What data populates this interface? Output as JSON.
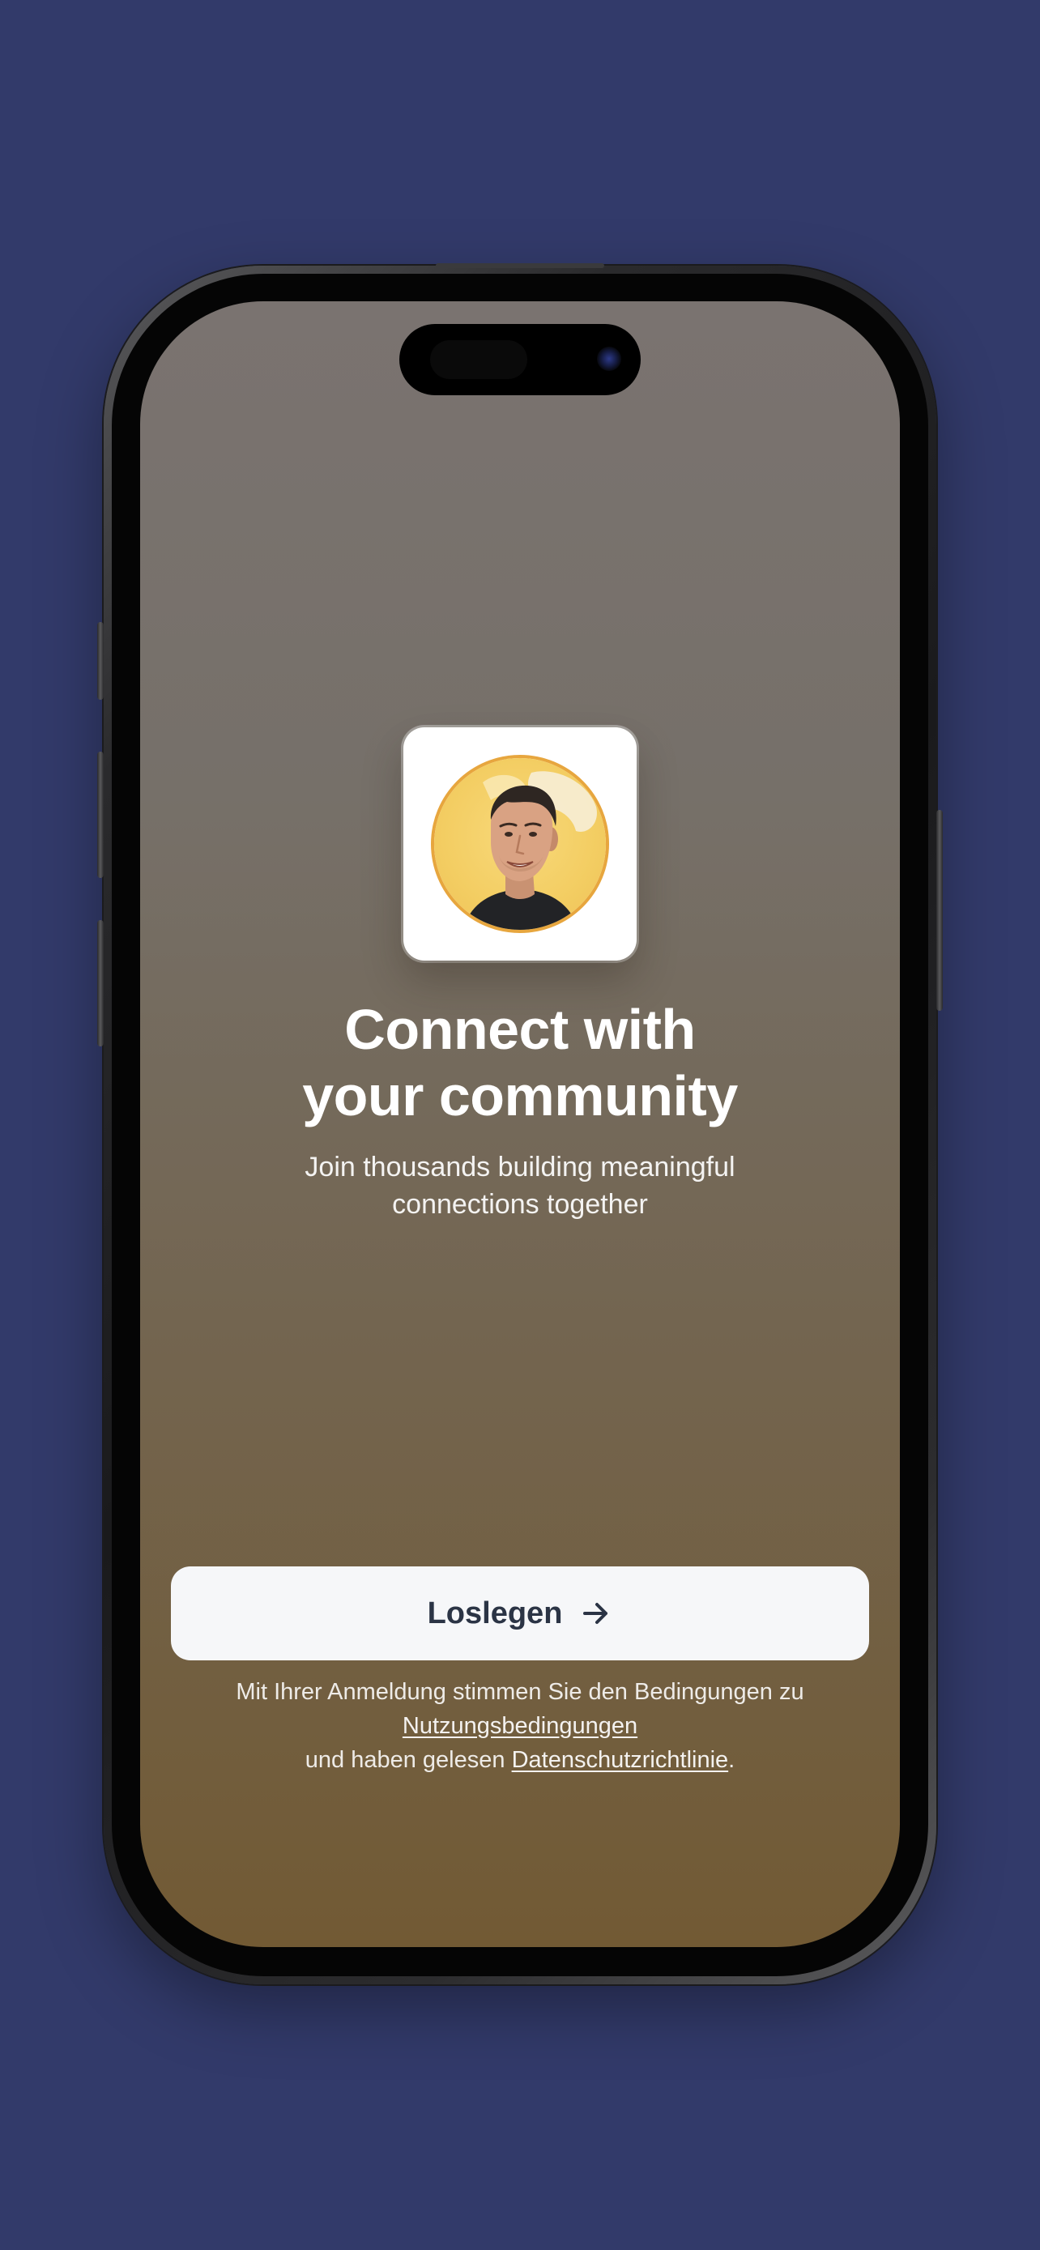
{
  "hero": {
    "headline_line1": "Connect with",
    "headline_line2": "your community",
    "subline_line1": "Join thousands building meaningful",
    "subline_line2": "connections together",
    "avatar_icon": "person-portrait"
  },
  "cta": {
    "label": "Loslegen",
    "icon": "arrow-right-icon"
  },
  "legal": {
    "line1": "Mit Ihrer Anmeldung stimmen Sie den Bedingungen zu",
    "terms_link": "Nutzungsbedingungen",
    "line3_prefix": "und haben gelesen ",
    "privacy_link": "Datenschutzrichtlinie",
    "line3_suffix": "."
  },
  "colors": {
    "page_background": "#323a6a",
    "screen_gradient_top": "#7a7370",
    "screen_gradient_bottom": "#725a34",
    "cta_background": "#f6f7f9",
    "cta_text": "#2b3445",
    "avatar_ring": "#e7a63e"
  }
}
